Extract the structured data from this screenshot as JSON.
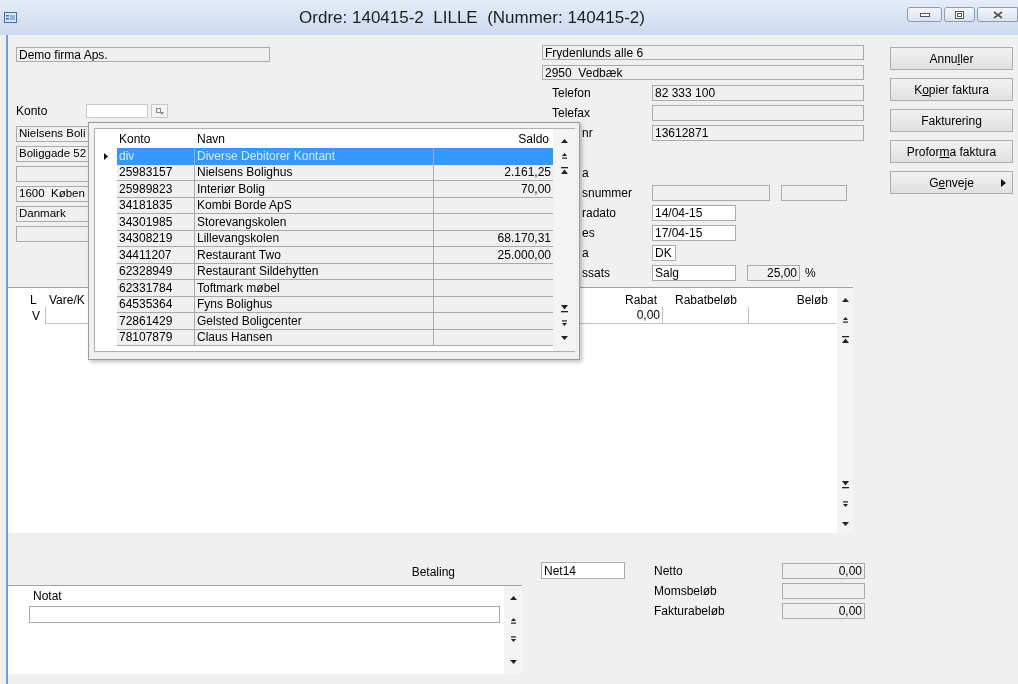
{
  "window": {
    "title": "Ordre: 140415-2  LILLE  (Nummer: 140415-2)"
  },
  "company": {
    "value": "Demo firma Aps.",
    "editable": false
  },
  "konto": {
    "label": "Konto"
  },
  "customer_fields": [
    {
      "value": "Nielsens Boli",
      "editable": false
    },
    {
      "value": "Boliggade 52",
      "editable": false
    },
    {
      "editable": false
    },
    {
      "value": "1600  Køben",
      "editable": false
    },
    {
      "value": "Danmark",
      "editable": false
    },
    {
      "editable": false
    }
  ],
  "address_fields": [
    {
      "value": "Frydenlunds alle 6",
      "editable": false
    },
    {
      "value": "2950  Vedbæk",
      "editable": false
    }
  ],
  "info_rows": [
    {
      "label": "Telefon",
      "fields": [
        {
          "value": "82 333 100",
          "editable": false
        }
      ]
    },
    {
      "label": "Telefax",
      "fields": [
        {
          "editable": false
        }
      ]
    },
    {
      "label": "nr",
      "fields": [
        {
          "value": "13612871",
          "editable": false
        }
      ]
    },
    {
      "label": "a"
    },
    {
      "label": "snummer",
      "fields": [
        {
          "editable": false
        },
        {
          "editable": false
        }
      ]
    },
    {
      "label": "radato",
      "fields": [
        {
          "value": "14/04-15",
          "editable": true
        }
      ]
    },
    {
      "label": "es",
      "fields": [
        {
          "value": "17/04-15",
          "editable": true
        }
      ]
    },
    {
      "label": "a",
      "fields": [
        {
          "value": "DK",
          "editable": true
        }
      ]
    },
    {
      "label": "ssats",
      "fields": [
        {
          "value": "Salg",
          "editable": true
        },
        {
          "value": "25,00",
          "editable": false
        }
      ],
      "suffix": "%"
    }
  ],
  "buttons": [
    {
      "label": "Annuller",
      "kind": "button"
    },
    {
      "label": "Kopier faktura",
      "kind": "button"
    },
    {
      "label": "Fakturering",
      "kind": "button"
    },
    {
      "label": "Proforma faktura",
      "kind": "button"
    },
    {
      "label": "Genveje",
      "kind": "menu"
    }
  ],
  "lines": {
    "columns": [
      "L",
      "Vare/K",
      "Rabat",
      "Rabatbeløb",
      "Beløb"
    ],
    "rows": [
      {
        "line_type": "V",
        "rabat": "0,00"
      }
    ]
  },
  "payment": {
    "label": "Betaling",
    "value": "Net14"
  },
  "totals": [
    {
      "label": "Netto",
      "value": "0,00"
    },
    {
      "label": "Momsbeløb"
    },
    {
      "label": "Fakturabeløb",
      "value": "0,00"
    }
  ],
  "notes": {
    "column": "Notat"
  },
  "lookup": {
    "columns": [
      "Konto",
      "Navn",
      "Saldo"
    ],
    "rows": [
      {
        "konto": "div",
        "navn": "Diverse Debitorer Kontant",
        "selected": true
      },
      {
        "konto": "25983157",
        "navn": "Nielsens Bolighus",
        "saldo": "2.161,25",
        "selected": false
      },
      {
        "konto": "25989823",
        "navn": "Interiør Bolig",
        "saldo": "70,00",
        "selected": false
      },
      {
        "konto": "34181835",
        "navn": "Kombi Borde ApS",
        "selected": false
      },
      {
        "konto": "34301985",
        "navn": "Storevangskolen",
        "selected": false
      },
      {
        "konto": "34308219",
        "navn": "Lillevangskolen",
        "saldo": "68.170,31",
        "selected": false
      },
      {
        "konto": "34411207",
        "navn": "Restaurant Two",
        "saldo": "25.000,00",
        "selected": false
      },
      {
        "konto": "62328949",
        "navn": "Restaurant Sildehytten",
        "selected": false
      },
      {
        "konto": "62331784",
        "navn": "Toftmark møbel",
        "selected": false
      },
      {
        "konto": "64535364",
        "navn": "Fyns Bolighus",
        "selected": false
      },
      {
        "konto": "72861429",
        "navn": "Gelsted Boligcenter",
        "selected": false
      },
      {
        "konto": "78107879",
        "navn": "Claus Hansen",
        "selected": false
      }
    ]
  }
}
